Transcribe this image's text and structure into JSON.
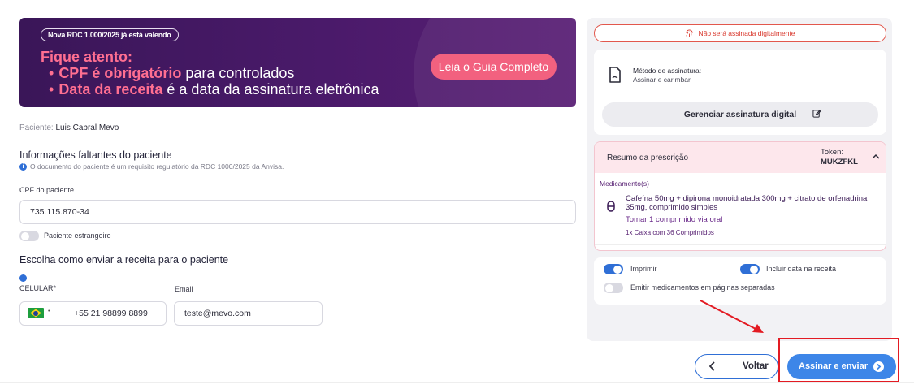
{
  "banner": {
    "badge": "Nova RDC 1.000/2025 já está valendo",
    "title": "Fique atento:",
    "line1_highlight": "CPF é obrigatório",
    "line1_rest": " para controlados",
    "line2_highlight": "Data da receita",
    "line2_rest": " é a data da assinatura eletrônica",
    "cta_label": "Leia o Guia Completo",
    "bullet": "•"
  },
  "patient": {
    "label": "Paciente:",
    "name": "Luis Cabral Mevo"
  },
  "missing_info": {
    "title": "Informações faltantes do paciente",
    "note": "O documento do paciente é um requisito regulatório da RDC 1000/2025 da Anvisa."
  },
  "cpf": {
    "label": "CPF do paciente",
    "value": "735.115.870-34"
  },
  "foreign_toggle": {
    "label": "Paciente estrangeiro",
    "on": false
  },
  "send": {
    "title": "Escolha como enviar a receita para o paciente",
    "phone_label": "CELULAR*",
    "phone_value": "+55 21 98899 8899",
    "email_label": "Email",
    "email_value": "teste@mevo.com"
  },
  "signature": {
    "warning": "Não será assinada digitalmente",
    "method_title": "Método de assinatura:",
    "method_value": "Assinar e carimbar",
    "manage_label": "Gerenciar assinatura digital"
  },
  "summary": {
    "title": "Resumo da prescrição",
    "token_label": "Token:",
    "token_value": "MUKZFKL",
    "meds_label": "Medicamento(s)",
    "med_name": "Cafeína 50mg + dipirona monoidratada 300mg + citrato de orfenadrina 35mg, comprimido simples",
    "med_dose": "Tomar 1 comprimido via oral",
    "med_qty": "1x Caixa com 36 Comprimidos"
  },
  "options": {
    "print_label": "Imprimir",
    "print_on": true,
    "date_label": "Incluir data na receita",
    "date_on": true,
    "separate_label": "Emitir medicamentos em páginas separadas",
    "separate_on": false
  },
  "actions": {
    "back_label": "Voltar",
    "send_label": "Assinar e enviar"
  },
  "colors": {
    "primary": "#3d86e8",
    "banner_bg": "#3a1658",
    "accent_pink": "#ff6f91",
    "warning_red": "#e2574c"
  }
}
